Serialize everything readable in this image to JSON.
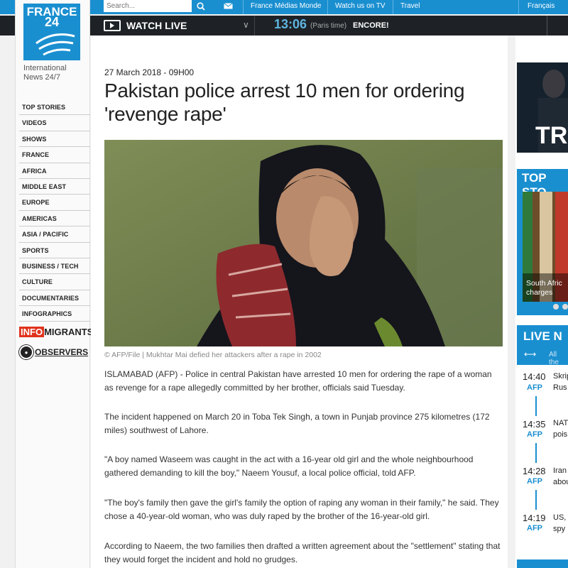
{
  "header": {
    "search_placeholder": "Search...",
    "links": [
      "France Médias Monde",
      "Watch us on TV",
      "Travel"
    ],
    "language": "Français"
  },
  "livebar": {
    "watch_label": "WATCH LIVE",
    "time": "13:06",
    "timezone": "(Paris time)",
    "program": "ENCORE!"
  },
  "brand": {
    "logo_line1": "FRANCE",
    "logo_line2": "24",
    "tagline_line1": "International",
    "tagline_line2": "News 24/7"
  },
  "nav": {
    "items": [
      "TOP STORIES",
      "VIDEOS",
      "SHOWS",
      "FRANCE",
      "AFRICA",
      "MIDDLE EAST",
      "EUROPE",
      "AMERICAS",
      "ASIA / PACIFIC",
      "SPORTS",
      "BUSINESS / TECH",
      "CULTURE",
      "DOCUMENTARIES",
      "INFOGRAPHICS"
    ],
    "infomigrants_info": "INFO",
    "infomigrants_rest": "MIGRANTS",
    "observers": "OBSERVERS"
  },
  "article": {
    "date": "27 March 2018 - 09H00",
    "headline": "Pakistan police arrest 10 men for ordering 'revenge rape'",
    "caption": "© AFP/File | Mukhtar Mai defied her attackers after a rape in 2002",
    "paragraphs": [
      "ISLAMABAD (AFP) - Police in central Pakistan have arrested 10 men for ordering the rape of a woman as revenge for a rape allegedly committed by her brother, officials said Tuesday.",
      "The incident happened on March 20 in Toba Tek Singh, a town in Punjab province 275 kilometres (172 miles) southwest of Lahore.",
      "\"A boy named Waseem was caught in the act with a 16-year old girl and the whole neighbourhood gathered demanding to kill the boy,\" Naeem Yousuf, a local police official, told AFP.",
      "\"The boy's family then gave the girl's family the option of raping any woman in their family,\" he said. They chose a 40-year-old woman, who was duly raped by the brother of the 16-year-old girl.",
      "According to Naeem, the two families then drafted a written agreement about the \"settlement\" stating that they would forget the incident and hold no grudges."
    ]
  },
  "sidebar": {
    "tv_thumb_text": "TR",
    "top_stories_title": "TOP STO",
    "top_story_caption_line1": "South Afric",
    "top_story_caption_line2": "charges",
    "live_news_title": "LIVE N",
    "live_news_all": "All the",
    "items": [
      {
        "time": "14:40",
        "source": "AFP",
        "line1": "Skrip",
        "line2": "Rus"
      },
      {
        "time": "14:35",
        "source": "AFP",
        "line1": "NAT",
        "line2": "pois"
      },
      {
        "time": "14:28",
        "source": "AFP",
        "line1": "Iran",
        "line2": "abou"
      },
      {
        "time": "14:19",
        "source": "AFP",
        "line1": "US,",
        "line2": "spy"
      }
    ]
  }
}
